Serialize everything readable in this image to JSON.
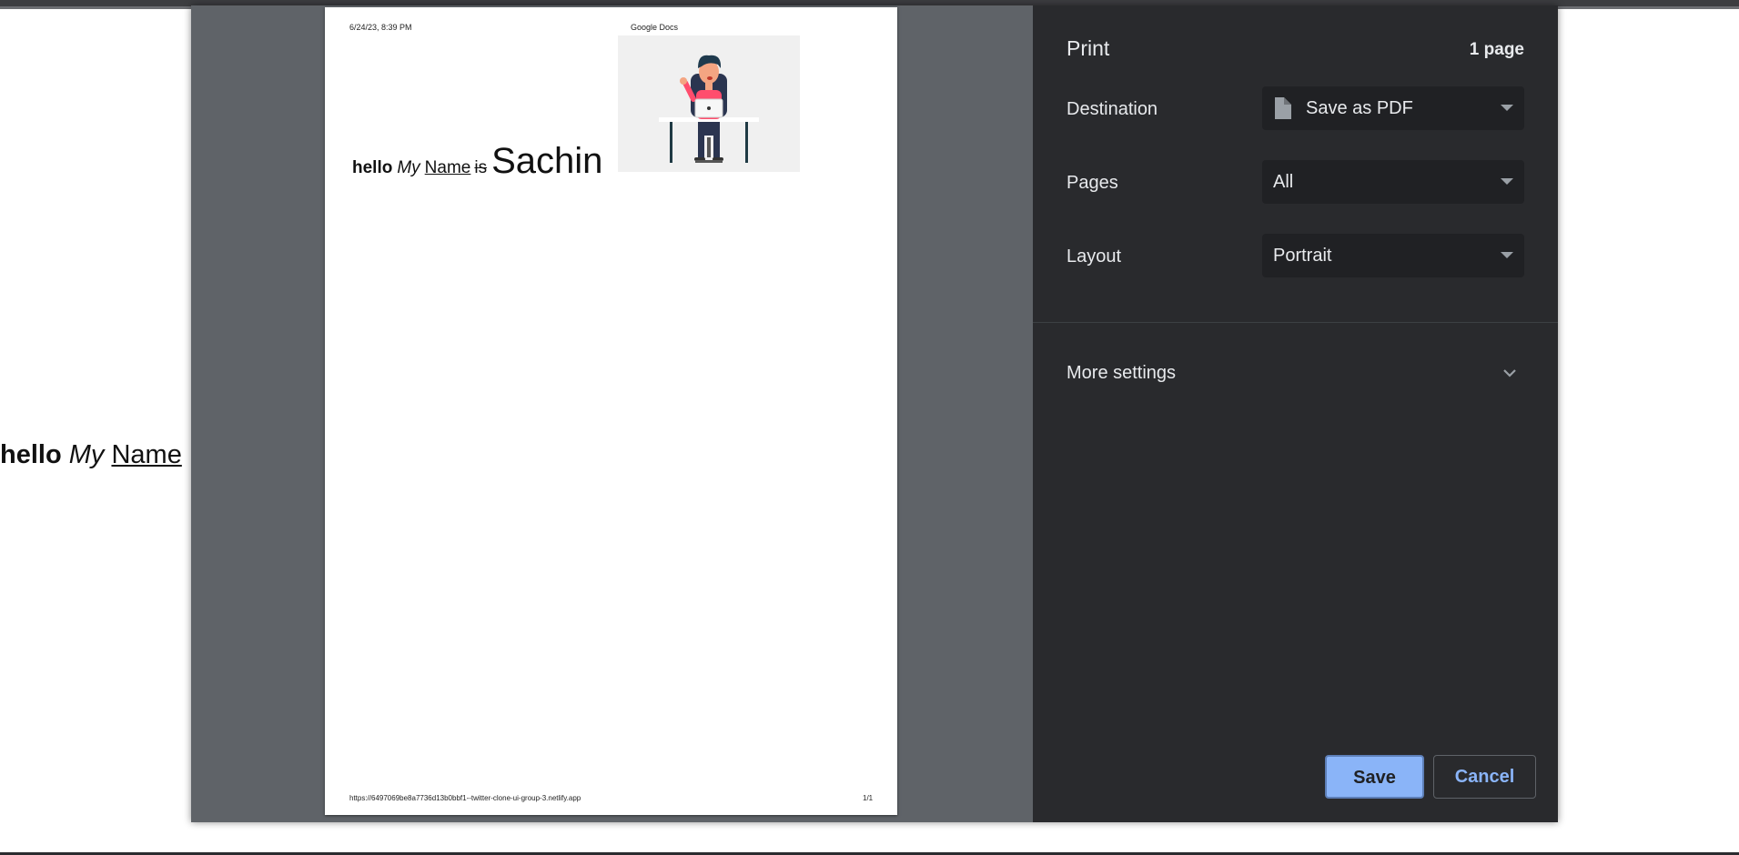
{
  "background_page": {
    "hello": "hello",
    "my": "My",
    "name": "Name"
  },
  "preview": {
    "header_date": "6/24/23, 8:39 PM",
    "header_title": "Google Docs",
    "doc_line": {
      "hello": "hello",
      "my": "My",
      "name": "Name",
      "is": "is",
      "sachin": "Sachin"
    },
    "footer_url": "https://6497069be8a7736d13b0bbf1--twitter-clone-ui-group-3.netlify.app",
    "footer_page": "1/1"
  },
  "print_panel": {
    "title": "Print",
    "page_count": "1 page",
    "destination": {
      "label": "Destination",
      "value": "Save as PDF",
      "icon": "file-icon"
    },
    "pages": {
      "label": "Pages",
      "value": "All"
    },
    "layout": {
      "label": "Layout",
      "value": "Portrait"
    },
    "more_settings": {
      "label": "More settings",
      "icon": "chevron-down-icon"
    },
    "buttons": {
      "save": "Save",
      "cancel": "Cancel"
    }
  },
  "colors": {
    "panel_bg": "#292a2d",
    "select_bg": "#202124",
    "preview_bg": "#5f6368",
    "accent": "#8ab4f8"
  }
}
